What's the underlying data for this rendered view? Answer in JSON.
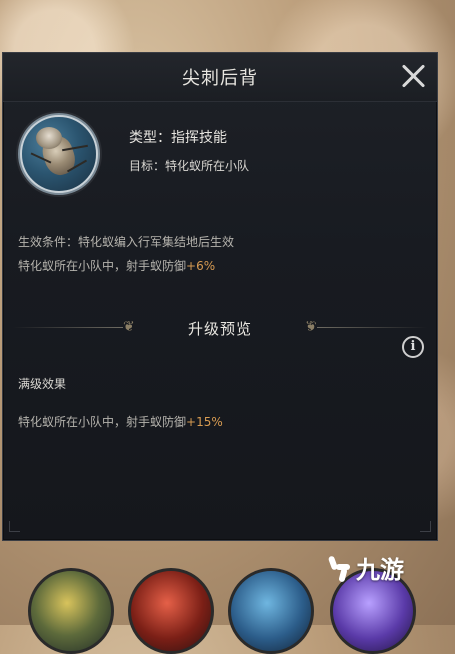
{
  "dialog": {
    "title": "尖刺后背",
    "skill_type": "类型：指挥技能",
    "target": "目标：特化蚁所在小队",
    "condition": "生效条件：特化蚁编入行军集结地后生效",
    "effect_prefix": "特化蚁所在小队中，射手蚁防御",
    "effect_value": "+6%",
    "upgrade_title": "升级预览",
    "max_label": "满级效果",
    "max_effect_prefix": "特化蚁所在小队中，射手蚁防御",
    "max_effect_value": "+15%",
    "info_glyph": "i"
  },
  "watermark": {
    "text": "九游"
  },
  "colors": {
    "accent_orange": "#d79b52",
    "panel_bg": "#1b1e23"
  }
}
